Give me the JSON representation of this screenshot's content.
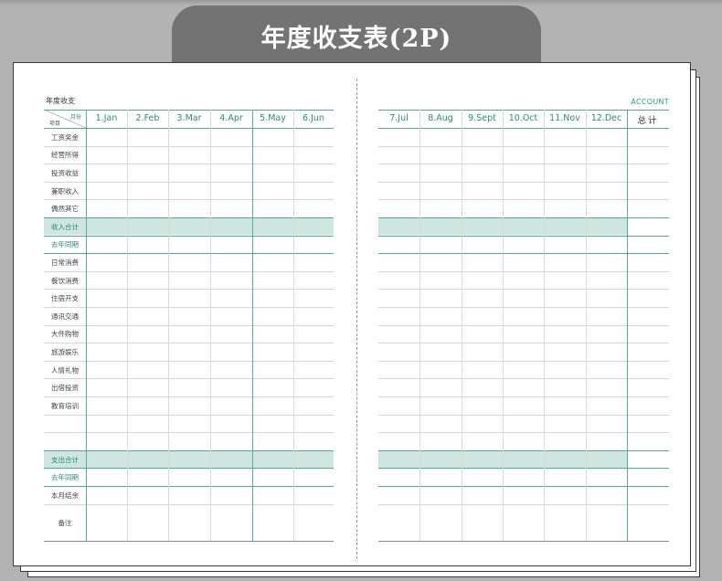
{
  "title": "年度收支表(2P)",
  "page": {
    "left_label": "年度收支",
    "right_label": "ACCOUNT",
    "corner_month": "月份",
    "corner_item": "项目"
  },
  "months_left": [
    "1.Jan",
    "2.Feb",
    "3.Mar",
    "4.Apr",
    "5.May",
    "6.Jun"
  ],
  "months_right": [
    "7.Jul",
    "8.Aug",
    "9.Sept",
    "10.Oct",
    "11.Nov",
    "12.Dec"
  ],
  "total_label": "总计",
  "rows": [
    {
      "label": "工资奖金",
      "kind": "item"
    },
    {
      "label": "经营所得",
      "kind": "item"
    },
    {
      "label": "投资收益",
      "kind": "item"
    },
    {
      "label": "兼职收入",
      "kind": "item"
    },
    {
      "label": "偶然其它",
      "kind": "item"
    },
    {
      "label": "收入合计",
      "kind": "total"
    },
    {
      "label": "去年同期",
      "kind": "teal"
    },
    {
      "label": "日常消费",
      "kind": "item"
    },
    {
      "label": "餐饮消费",
      "kind": "item"
    },
    {
      "label": "住宿开支",
      "kind": "item"
    },
    {
      "label": "通讯交通",
      "kind": "item"
    },
    {
      "label": "大件购物",
      "kind": "item"
    },
    {
      "label": "旅游娱乐",
      "kind": "item"
    },
    {
      "label": "人情礼物",
      "kind": "item"
    },
    {
      "label": "出借投资",
      "kind": "item"
    },
    {
      "label": "教育培训",
      "kind": "item"
    },
    {
      "label": "",
      "kind": "item"
    },
    {
      "label": "",
      "kind": "item"
    },
    {
      "label": "支出合计",
      "kind": "total"
    },
    {
      "label": "去年同期",
      "kind": "teal"
    },
    {
      "label": "本月结余",
      "kind": "item"
    },
    {
      "label": "备注",
      "kind": "note"
    }
  ],
  "colors": {
    "accent": "#2a8a74",
    "band": "#cfe5e0",
    "title_bg": "#737373",
    "background": "#b3b3b3"
  }
}
